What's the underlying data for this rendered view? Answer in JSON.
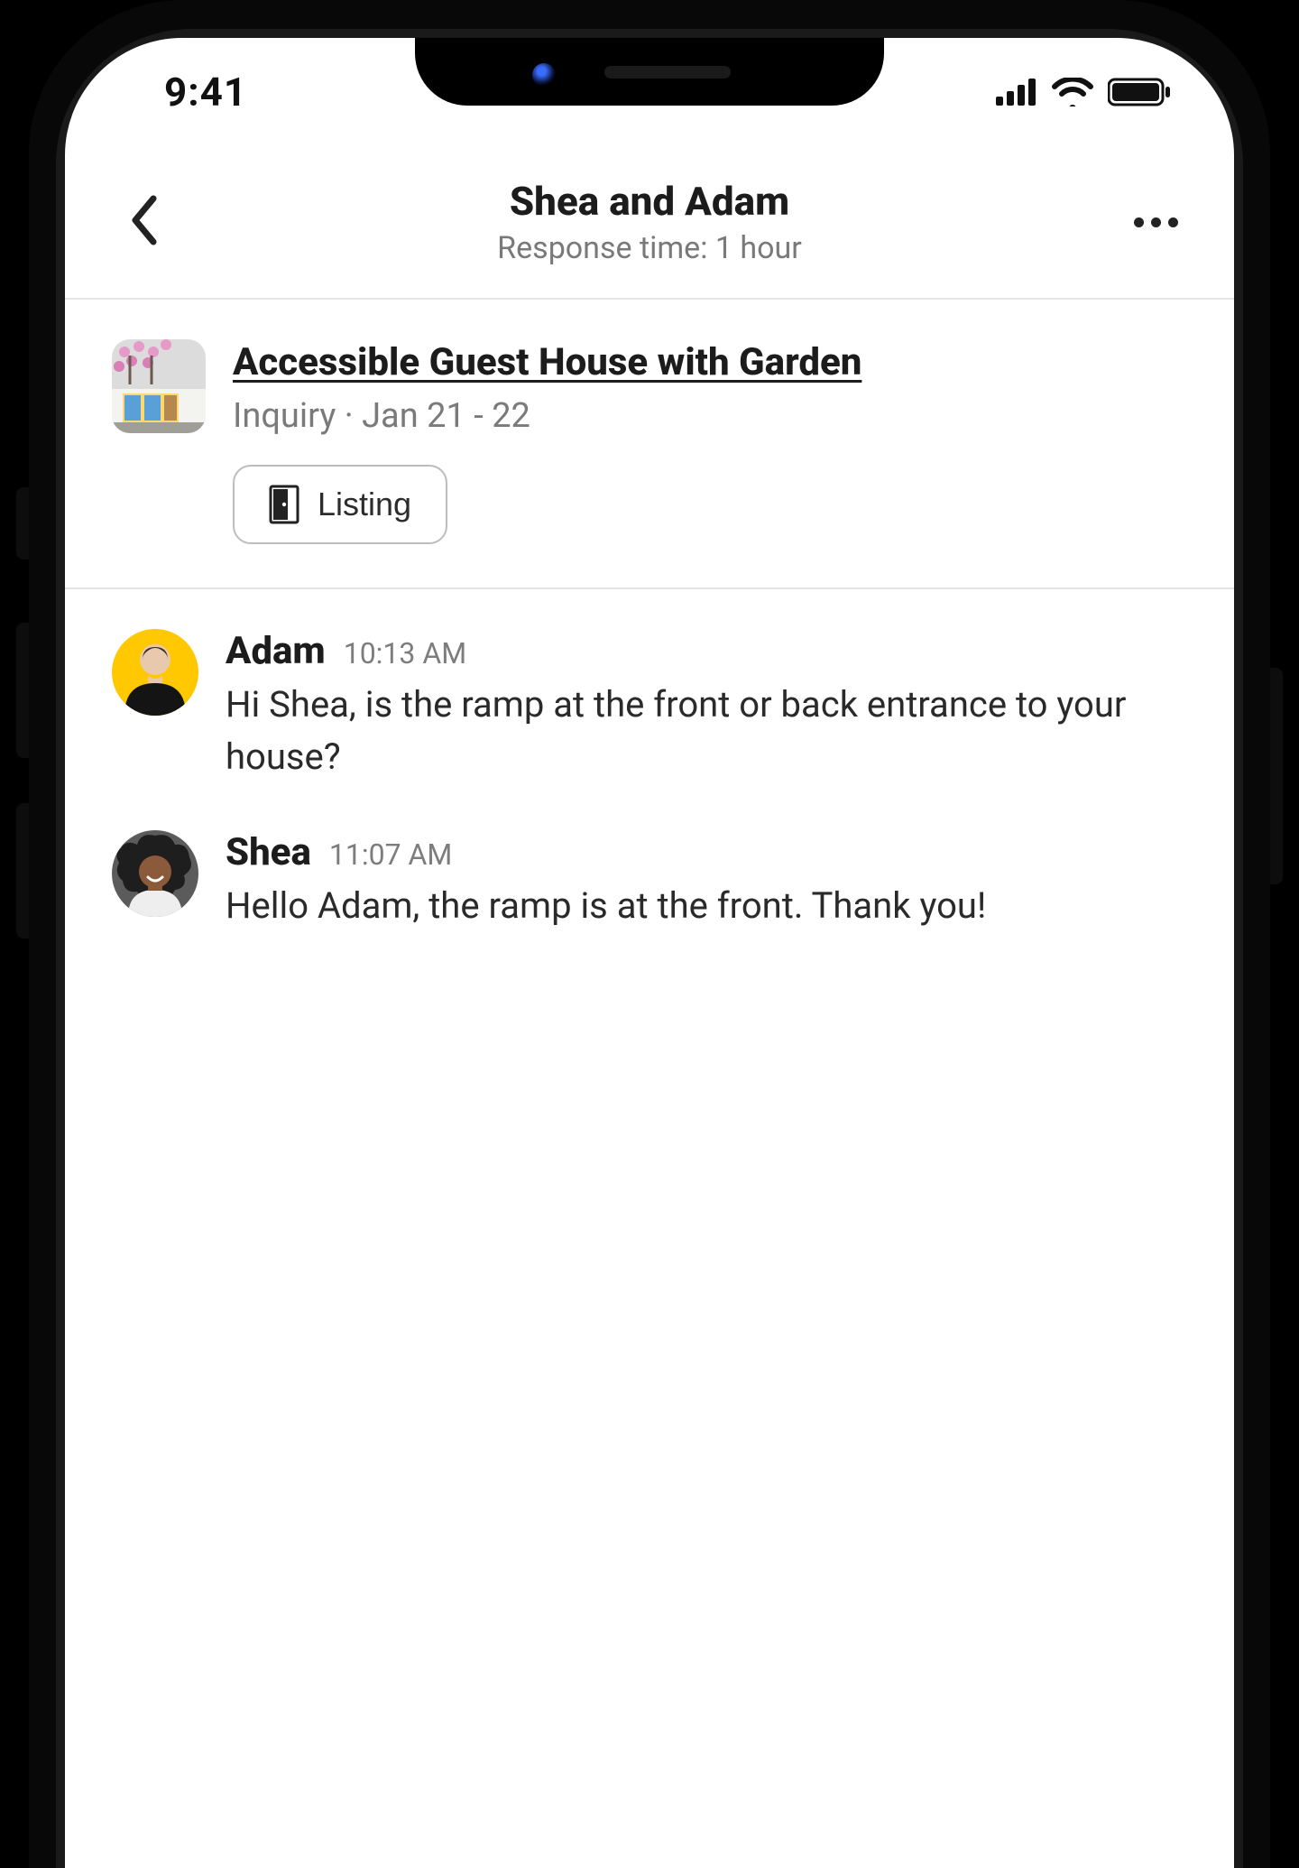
{
  "status": {
    "time": "9:41"
  },
  "header": {
    "title": "Shea and Adam",
    "subtitle": "Response time: 1 hour"
  },
  "listing": {
    "title": "Accessible Guest House with Garden",
    "meta": "Inquiry · Jan 21 - 22",
    "button_label": "Listing"
  },
  "messages": [
    {
      "sender": "Adam",
      "time": "10:13 AM",
      "text": "Hi Shea, is the ramp at the front or back entrance to your house?",
      "avatar_bg": "#ffc800",
      "avatar_kind": "person-dark-shirt"
    },
    {
      "sender": "Shea",
      "time": "11:07 AM",
      "text": "Hello Adam, the ramp is at the front. Thank you!",
      "avatar_bg": "#5b5b5b",
      "avatar_kind": "person-curly"
    }
  ]
}
